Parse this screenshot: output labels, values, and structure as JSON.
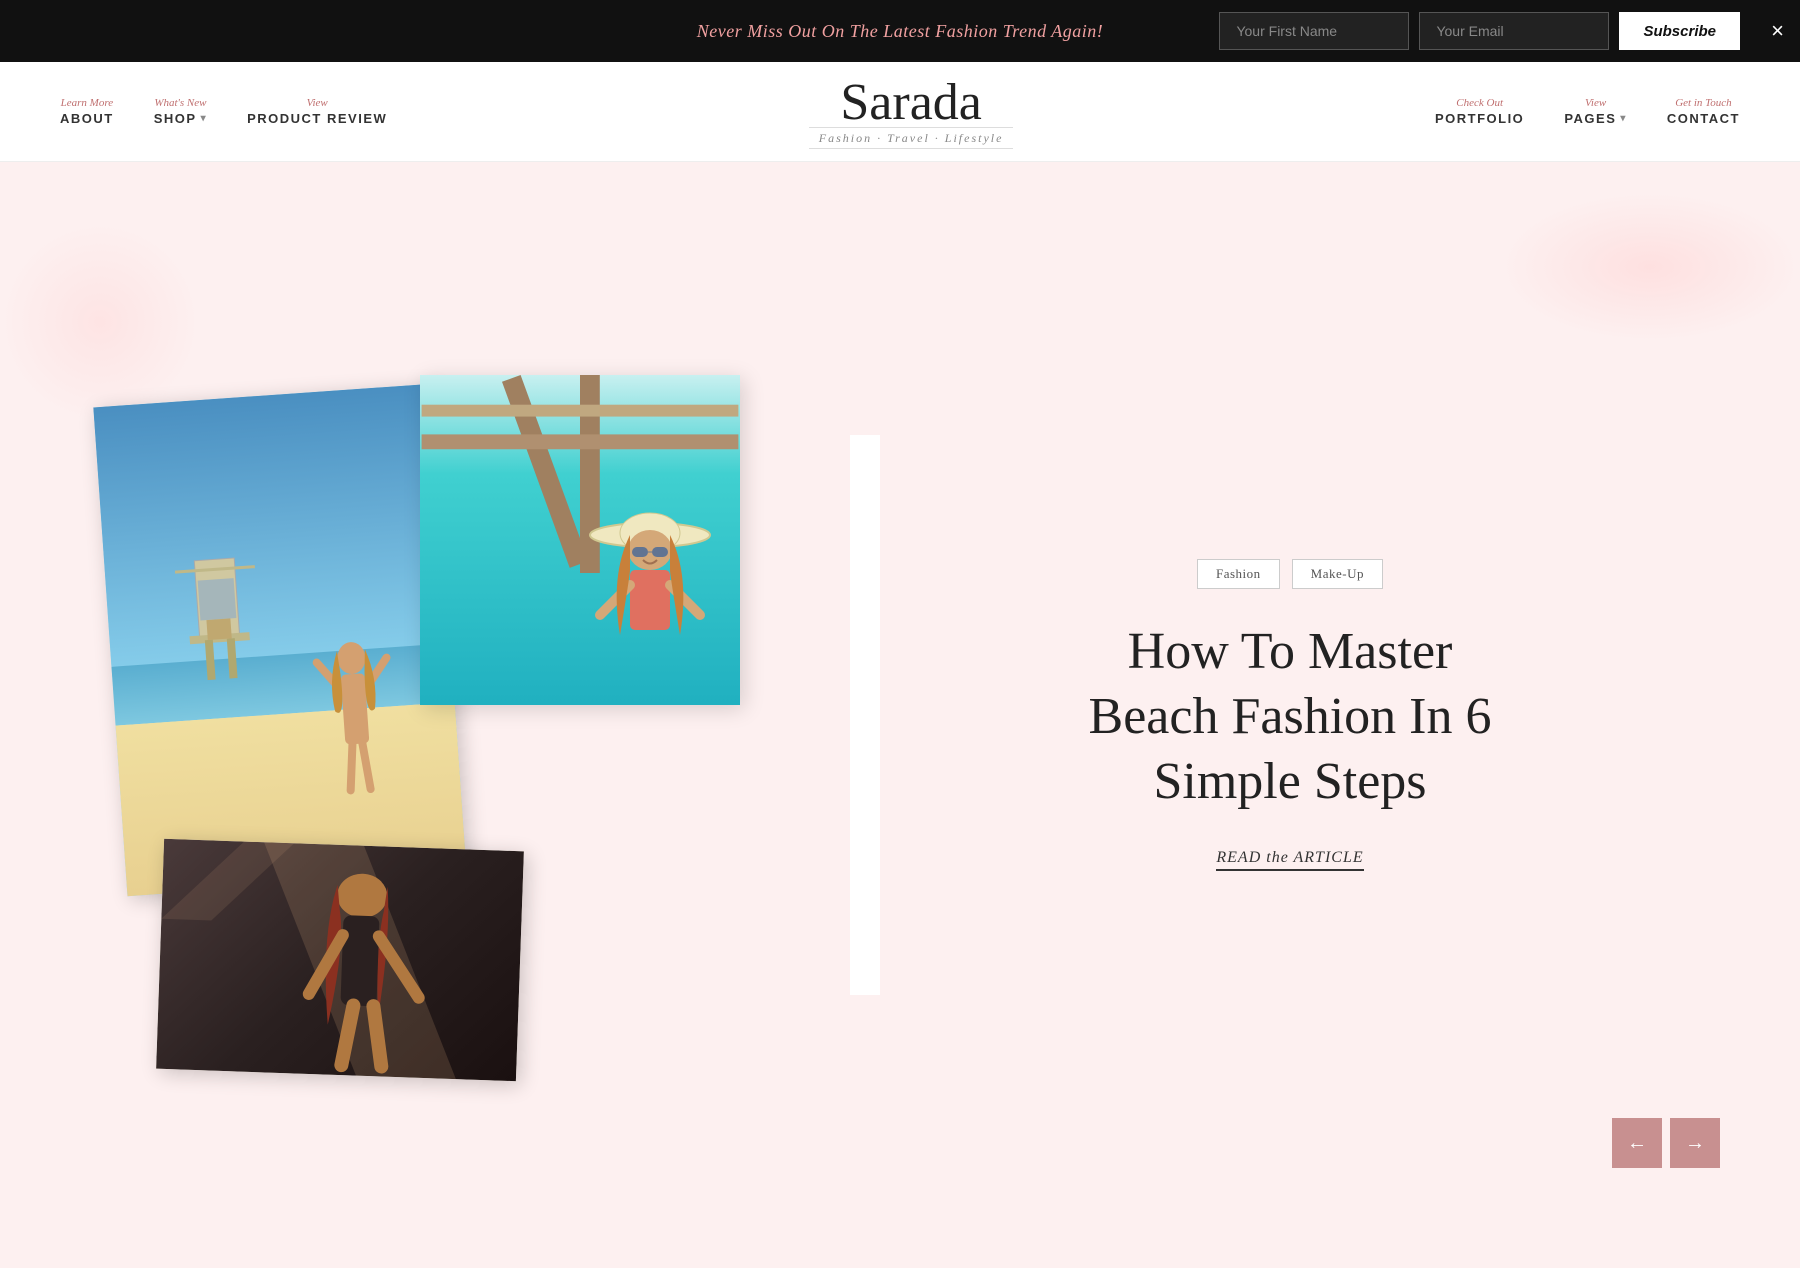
{
  "topBanner": {
    "text": "Never Miss Out On The Latest Fashion Trend Again!",
    "firstNamePlaceholder": "Your First Name",
    "emailPlaceholder": "Your Email",
    "subscribeLabel": "Subscribe",
    "closeLabel": "×"
  },
  "nav": {
    "logo": "Sarada",
    "tagline": "Fashion · Travel · Lifestyle",
    "leftItems": [
      {
        "hint": "Learn More",
        "label": "ABOUT",
        "hasDropdown": false
      },
      {
        "hint": "What's New",
        "label": "SHOP",
        "hasDropdown": true
      },
      {
        "hint": "View",
        "label": "PRODUCT REVIEW",
        "hasDropdown": false
      }
    ],
    "rightItems": [
      {
        "hint": "Check Out",
        "label": "PORTFOLIO",
        "hasDropdown": false
      },
      {
        "hint": "View",
        "label": "PAGES",
        "hasDropdown": true
      },
      {
        "hint": "Get in Touch",
        "label": "CONTACT",
        "hasDropdown": false
      }
    ]
  },
  "hero": {
    "tags": [
      "Fashion",
      "Make-Up"
    ],
    "title": "How To Master Beach Fashion In 6 Simple Steps",
    "readArticleLabel": "READ the ARTICLE"
  },
  "arrows": {
    "prev": "←",
    "next": "→"
  }
}
